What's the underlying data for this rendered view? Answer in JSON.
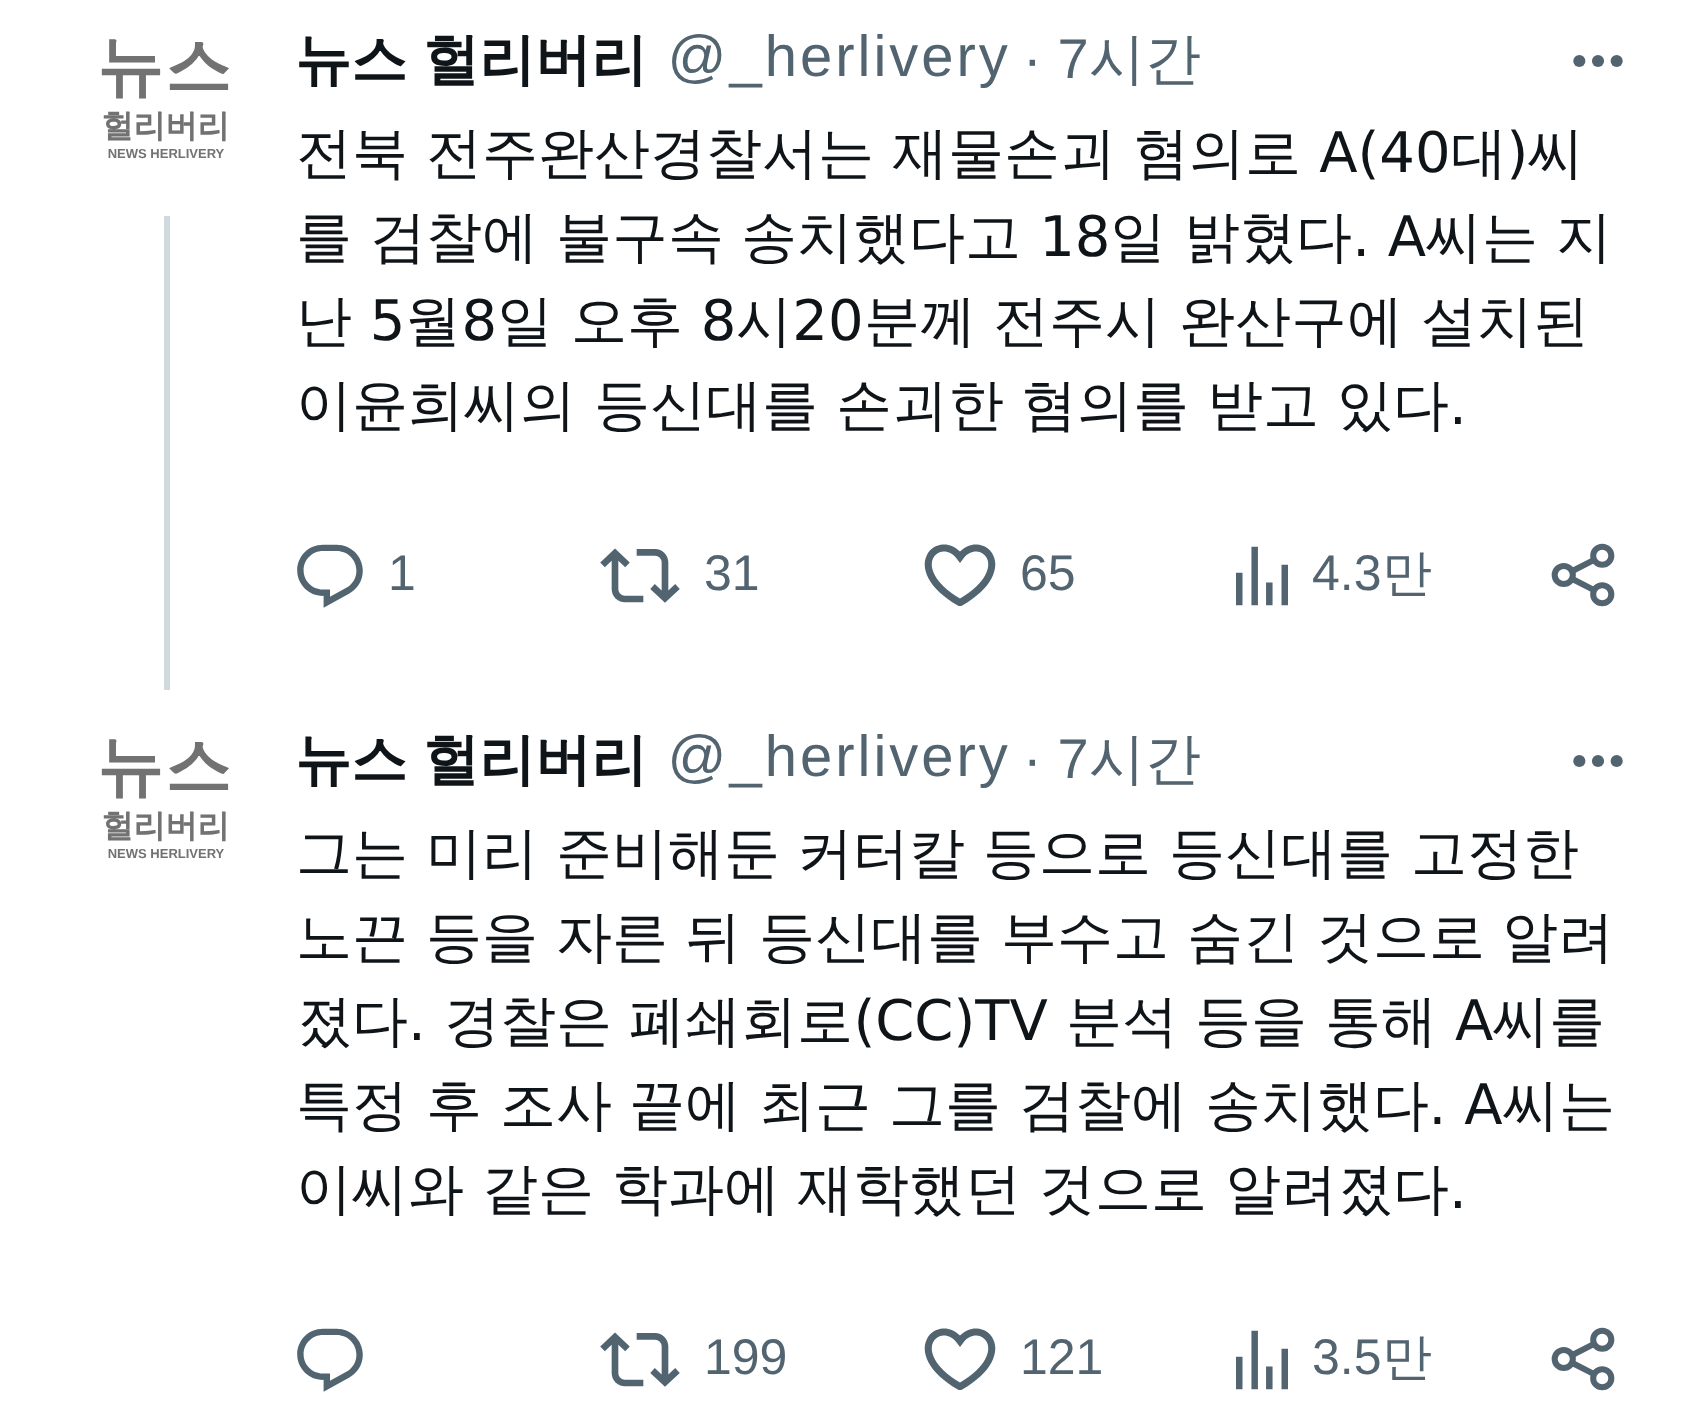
{
  "tweets": [
    {
      "avatar": {
        "line_1": "뉴스",
        "line_2": "헐리버리",
        "line_3": "NEWS HERLIVERY"
      },
      "name": "뉴스 헐리버리",
      "handle": "@_herlivery",
      "separator": "·",
      "time": "7시간",
      "thread_line": true,
      "text": "전북 전주완산경찰서는 재물손괴 혐의로 A(40대)씨를 검찰에 불구속 송치했다고 18일 밝혔다. A씨는 지난 5월8일 오후 8시20분께 전주시 완산구에 설치된 이윤희씨의 등신대를 손괴한 혐의를 받고 있다.",
      "actions": [
        {
          "kind": "reply",
          "count": "1"
        },
        {
          "kind": "retweet",
          "count": "31"
        },
        {
          "kind": "like",
          "count": "65"
        },
        {
          "kind": "views",
          "count": "4.3만"
        },
        {
          "kind": "share"
        }
      ]
    },
    {
      "avatar": {
        "line_1": "뉴스",
        "line_2": "헐리버리",
        "line_3": "NEWS HERLIVERY"
      },
      "name": "뉴스 헐리버리",
      "handle": "@_herlivery",
      "separator": "·",
      "time": "7시간",
      "thread_line": false,
      "text": "그는 미리 준비해둔 커터칼 등으로 등신대를 고정한 노끈 등을 자른 뒤 등신대를 부수고 숨긴 것으로 알려졌다. 경찰은 폐쇄회로(CC)TV 분석 등을 통해 A씨를 특정 후 조사 끝에 최근 그를 검찰에 송치했다. A씨는 이씨와 같은 학과에 재학했던 것으로 알려졌다.",
      "actions": [
        {
          "kind": "reply"
        },
        {
          "kind": "retweet",
          "count": "199"
        },
        {
          "kind": "like",
          "count": "121"
        },
        {
          "kind": "views",
          "count": "3.5만"
        },
        {
          "kind": "share"
        }
      ]
    }
  ]
}
